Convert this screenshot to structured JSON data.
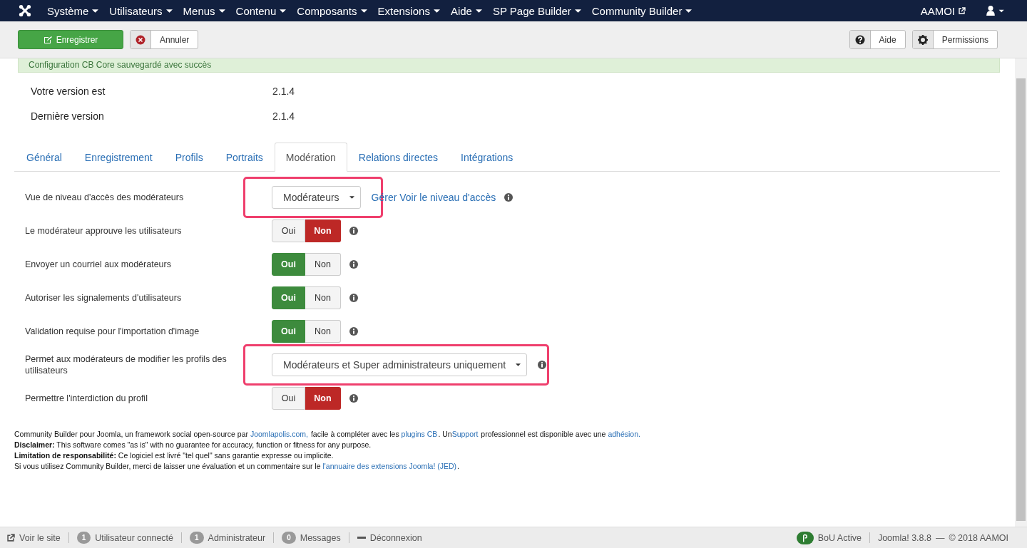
{
  "navbar": {
    "menus": [
      "Système",
      "Utilisateurs",
      "Menus",
      "Contenu",
      "Composants",
      "Extensions",
      "Aide",
      "SP Page Builder",
      "Community Builder"
    ],
    "site_link": "AAMOI"
  },
  "toolbar": {
    "left": [
      {
        "label": "Enregistrer",
        "kind": "primary"
      },
      {
        "label": "Annuler",
        "kind": "cancel"
      }
    ],
    "right": [
      {
        "label": "Aide",
        "kind": "help"
      },
      {
        "label": "Permissions",
        "kind": "settings"
      }
    ]
  },
  "alert": "Configuration CB Core sauvegardé avec succès",
  "versions": [
    {
      "label": "Votre version est",
      "value": "2.1.4"
    },
    {
      "label": "Dernière version",
      "value": "2.1.4"
    }
  ],
  "tabs": [
    {
      "label": "Général",
      "selected": false
    },
    {
      "label": "Enregistrement",
      "selected": false
    },
    {
      "label": "Profils",
      "selected": false
    },
    {
      "label": "Portraits",
      "selected": false
    },
    {
      "label": "Modération",
      "selected": true
    },
    {
      "label": "Relations directes",
      "selected": false
    },
    {
      "label": "Intégrations",
      "selected": false
    }
  ],
  "settings": [
    {
      "label": "Vue de niveau d'accès des modérateurs",
      "kind": "select",
      "value": "Modérateurs",
      "highlighted": true,
      "link": "Gérer Voir le niveau d'accès"
    },
    {
      "label": "Le modérateur approuve les utilisateurs",
      "kind": "toggle",
      "options": [
        {
          "label": "Oui",
          "selected": false
        },
        {
          "label": "Non",
          "selected": true
        }
      ]
    },
    {
      "label": "Envoyer un courriel aux modérateurs",
      "kind": "toggle",
      "options": [
        {
          "label": "Oui",
          "selected": true
        },
        {
          "label": "Non",
          "selected": false
        }
      ]
    },
    {
      "label": "Autoriser les signalements d'utilisateurs",
      "kind": "toggle",
      "options": [
        {
          "label": "Oui",
          "selected": true
        },
        {
          "label": "Non",
          "selected": false
        }
      ]
    },
    {
      "label": "Validation requise pour l'importation d'image",
      "kind": "toggle",
      "options": [
        {
          "label": "Oui",
          "selected": true
        },
        {
          "label": "Non",
          "selected": false
        }
      ]
    },
    {
      "label": "Permet aux modérateurs de modifier les profils des utilisateurs",
      "kind": "select",
      "value": "Modérateurs et Super administrateurs uniquement",
      "highlighted": true
    },
    {
      "label": "Permettre l'interdiction du profil",
      "kind": "toggle",
      "options": [
        {
          "label": "Oui",
          "selected": false
        },
        {
          "label": "Non",
          "selected": true
        }
      ]
    }
  ],
  "footer": [
    [
      {
        "text": "Community Builder pour Joomla, un framework social open-source par "
      },
      {
        "text": "Joomlapolis.com,",
        "link": true
      },
      {
        "text": " facile à compléter avec les "
      },
      {
        "text": "plugins CB",
        "link": true
      },
      {
        "text": ". Un"
      },
      {
        "text": "Support",
        "link": true
      },
      {
        "text": " professionnel est disponible avec une "
      },
      {
        "text": "adhésion.",
        "link": true
      }
    ],
    [
      {
        "text": "**Disclaimer:** This software comes \"as is\" with no guarantee for accuracy, function or fitness for any purpose."
      }
    ],
    [
      {
        "text": "**Limitation de responsabilité:** Ce logiciel est livré \"tel quel\" sans garantie expresse ou implicite."
      }
    ],
    [
      {
        "text": "Si vous utilisez Community Builder, merci de laisser une évaluation et un commentaire sur le "
      },
      {
        "text": "l'annuaire des extensions Joomla! (JED)",
        "link": true
      },
      {
        "text": "."
      }
    ]
  ],
  "status_bar": {
    "left": [
      {
        "label": "Voir le site",
        "kind": "site"
      },
      {
        "label": "Utilisateur connecté",
        "count": "1",
        "kind": "count"
      },
      {
        "label": "Administrateur",
        "count": "1",
        "kind": "count"
      },
      {
        "label": "Messages",
        "count": "0",
        "kind": "count"
      },
      {
        "label": "Déconnexion",
        "kind": "logout"
      }
    ],
    "badge": "BoU Active",
    "version": "Joomla! 3.8.8",
    "dash": "—",
    "copyright": "© 2018 AAMOI"
  }
}
